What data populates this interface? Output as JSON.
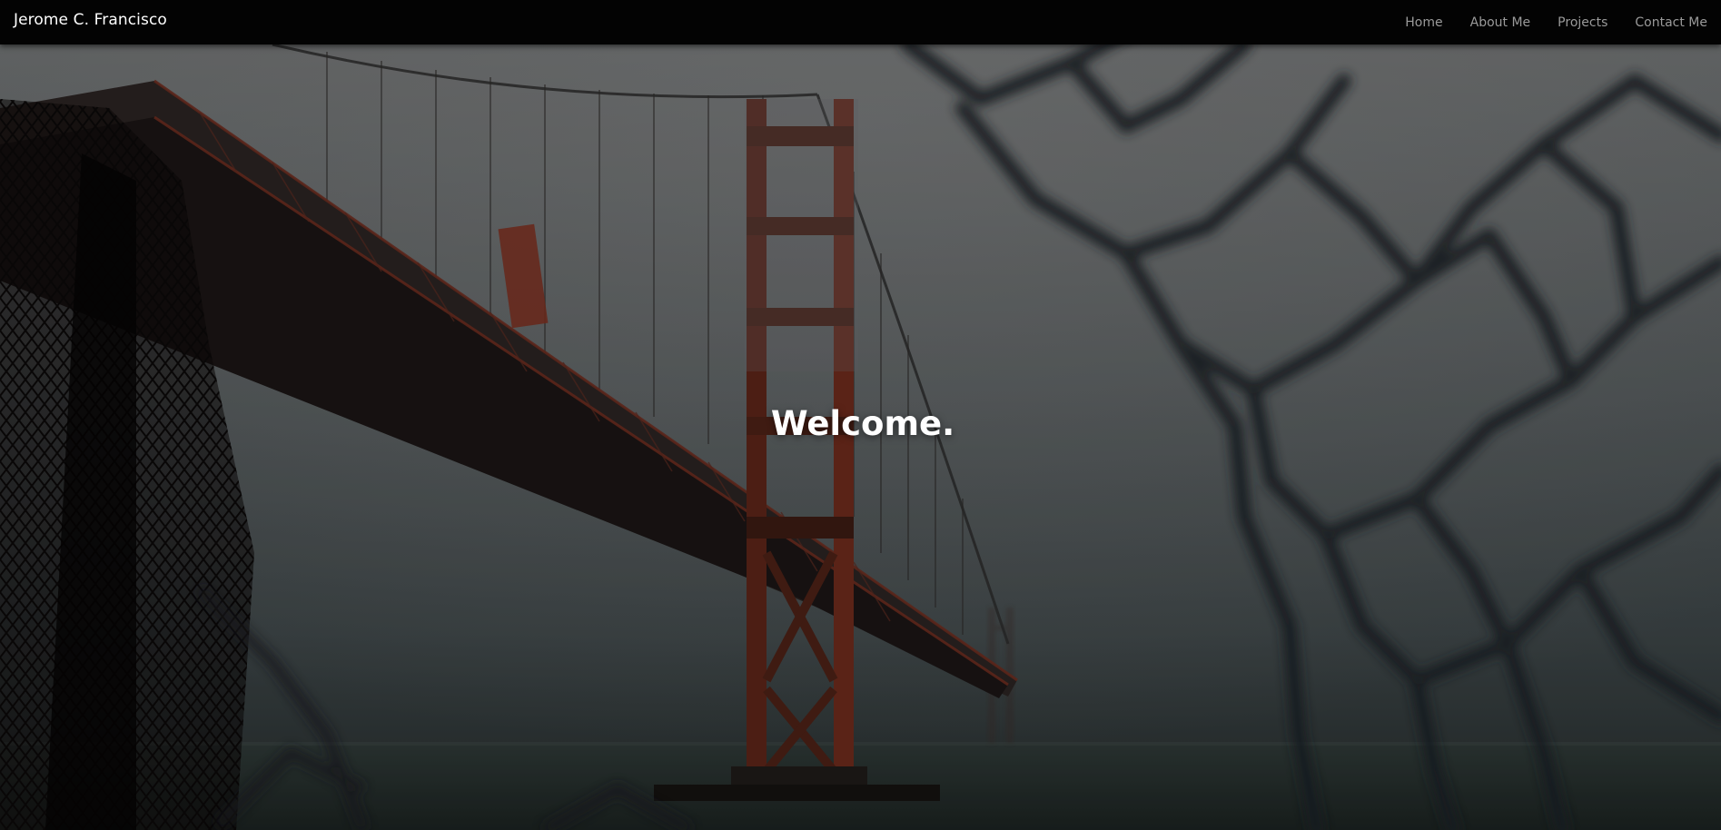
{
  "navbar": {
    "brand": "Jerome C. Francisco",
    "links": [
      {
        "label": "Home"
      },
      {
        "label": "About Me"
      },
      {
        "label": "Projects"
      },
      {
        "label": "Contact Me"
      }
    ]
  },
  "hero": {
    "heading": "Welcome.",
    "background_image": "golden-gate-bridge-through-chain-link-fence-in-fog"
  },
  "colors": {
    "navbar_bg": "#030303",
    "brand_text": "#ffffff",
    "nav_link_text": "#9a9a9a",
    "heading_text": "#ffffff",
    "bridge_red": "#7a2e1f",
    "fog_gray": "#4f5557"
  }
}
